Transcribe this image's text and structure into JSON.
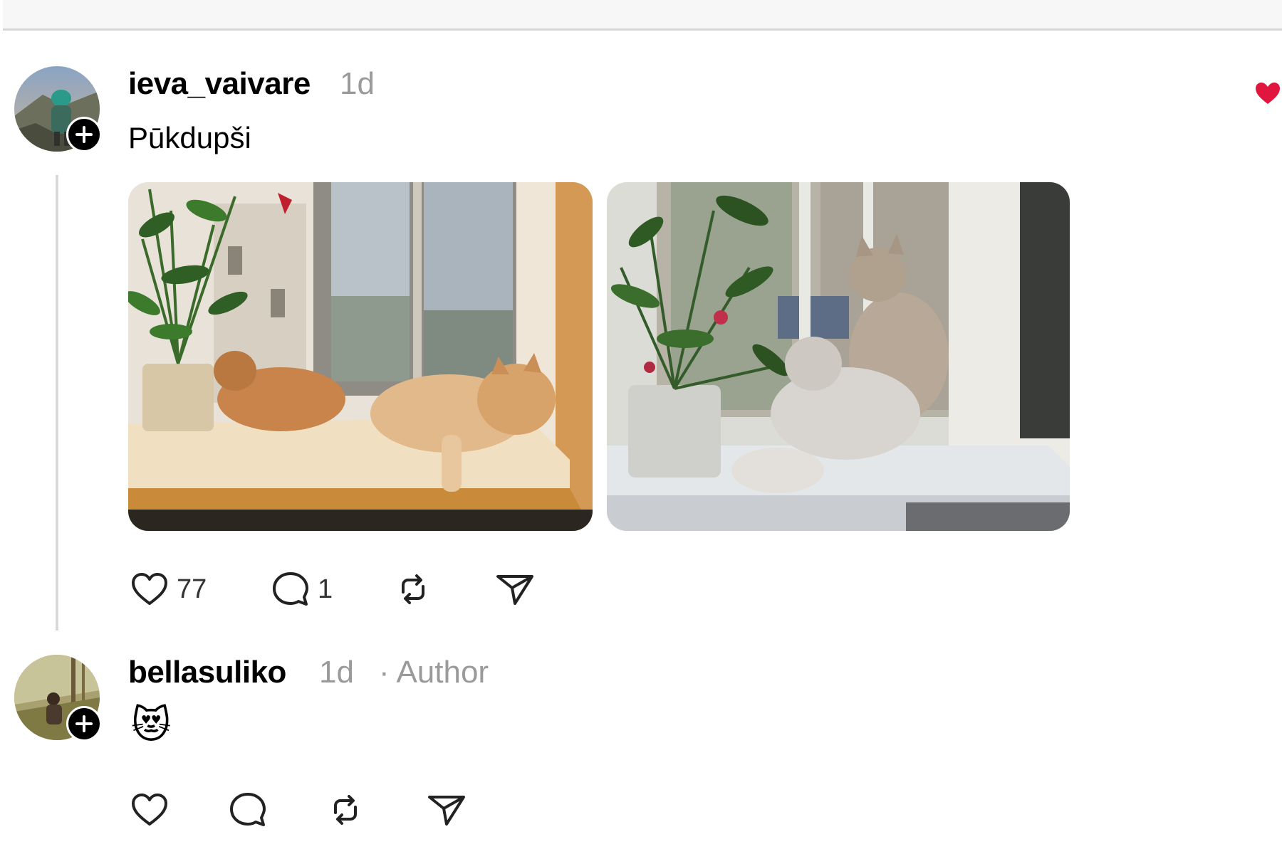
{
  "post": {
    "username": "ieva_vaivare",
    "time": "1d",
    "text": "Pūkdupši",
    "like_count": "77",
    "reply_count": "1"
  },
  "reply": {
    "username": "bellasuliko",
    "time": "1d",
    "author_tag": "· Author",
    "text": "😻"
  },
  "icons": {
    "follow": "plus-icon",
    "like": "heart-icon",
    "comment": "comment-icon",
    "repost": "repost-icon",
    "share": "send-icon",
    "liked_indicator": "red-heart-icon"
  },
  "colors": {
    "text": "#000000",
    "muted": "#9a9a9a",
    "divider": "#d6d6d6",
    "liked": "#e0163e"
  }
}
